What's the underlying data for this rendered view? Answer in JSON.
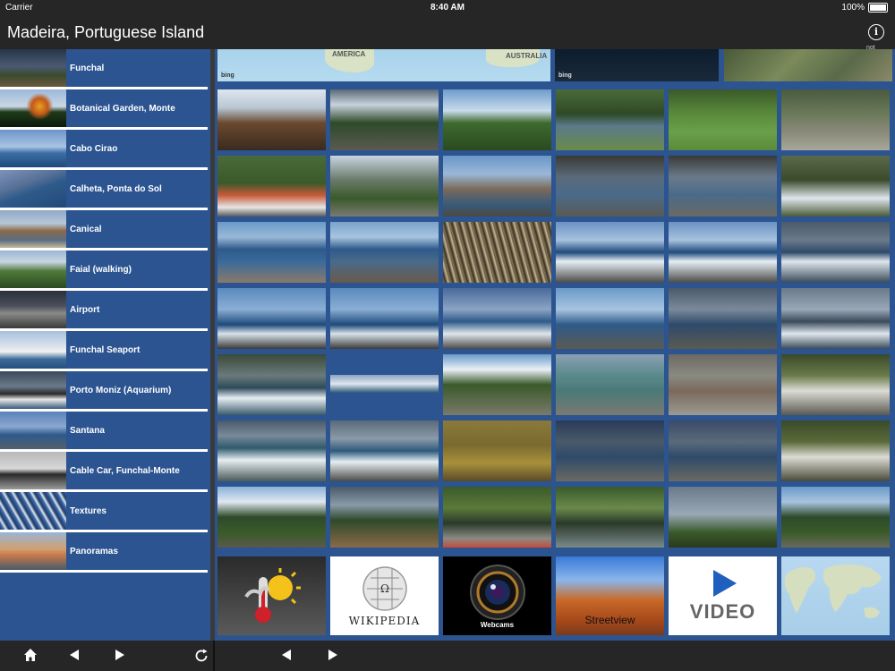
{
  "status": {
    "carrier": "Carrier",
    "time": "8:40 AM",
    "battery": "100%"
  },
  "header": {
    "title": "Madeira, Portuguese Island",
    "info_caption": "not"
  },
  "map": {
    "label_america": "AMERICA",
    "label_australia": "AUSTRALIA",
    "bing": "bing"
  },
  "sidebar": {
    "items": [
      {
        "label": "Funchal"
      },
      {
        "label": "Botanical Garden, Monte"
      },
      {
        "label": "Cabo Cirao"
      },
      {
        "label": "Calheta, Ponta do Sol"
      },
      {
        "label": "Canical"
      },
      {
        "label": "Faial (walking)"
      },
      {
        "label": "Airport"
      },
      {
        "label": "Funchal Seaport"
      },
      {
        "label": "Porto Moniz (Aquarium)"
      },
      {
        "label": "Santana"
      },
      {
        "label": "Cable Car, Funchal-Monte"
      },
      {
        "label": "Textures"
      },
      {
        "label": "Panoramas"
      }
    ]
  },
  "tools": {
    "wikipedia": "WIKIPEDIA",
    "webcams": "Webcams",
    "streetview": "Streetview",
    "video": "VIDEO"
  },
  "colors": {
    "panel": "#2b5491",
    "bar": "#262626"
  },
  "icons": {
    "home": "home-icon",
    "back": "arrow-left-icon",
    "forward": "arrow-right-icon",
    "reload": "reload-icon"
  }
}
